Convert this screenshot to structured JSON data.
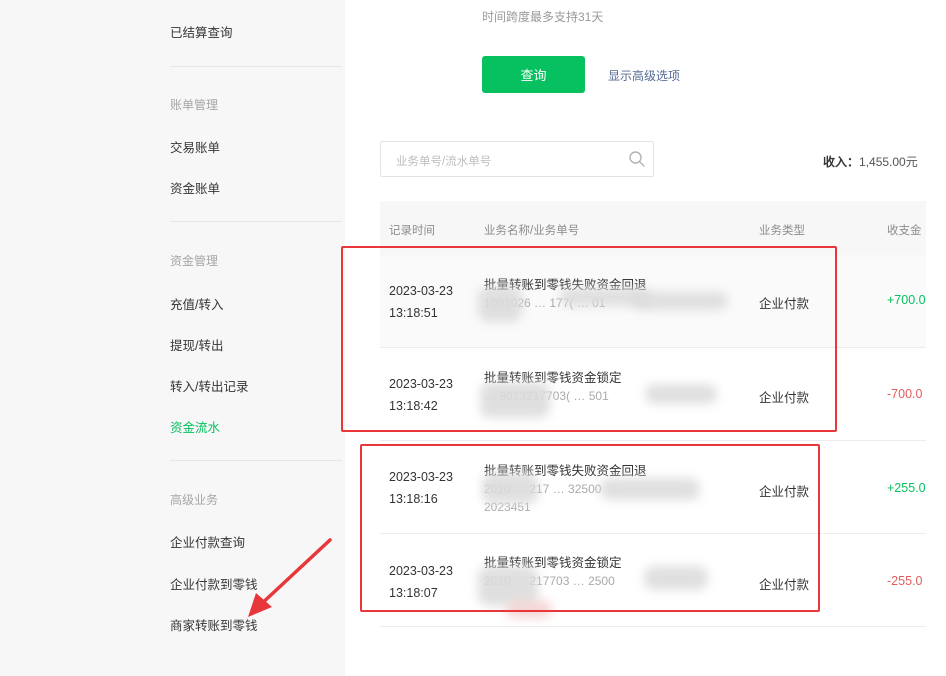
{
  "sidebar": {
    "top_item": "已结算查询",
    "groups": [
      {
        "title": "账单管理",
        "items": [
          "交易账单",
          "资金账单"
        ]
      },
      {
        "title": "资金管理",
        "items": [
          "充值/转入",
          "提现/转出",
          "转入/转出记录",
          "资金流水"
        ]
      },
      {
        "title": "高级业务",
        "items": [
          "企业付款查询",
          "企业付款到零钱",
          "商家转账到零钱"
        ]
      }
    ],
    "active_item": "资金流水",
    "accent_color": "#07c160"
  },
  "filters": {
    "hint": "时间跨度最多支持31天",
    "query_button": "查询",
    "advanced_link": "显示高级选项"
  },
  "search": {
    "placeholder": "业务单号/流水单号",
    "icon": "search-icon"
  },
  "summary": {
    "income_label": "收入：",
    "income_value": "1,455.00元"
  },
  "table": {
    "headers": [
      "记录时间",
      "业务名称/业务单号",
      "业务类型",
      "收支金"
    ],
    "rows": [
      {
        "date": "2023-03-23",
        "time": "13:18:51",
        "name": "批量转账到零钱失败资金回退",
        "number": "1001026 … 177( … 01",
        "type": "企业付款",
        "amount": "+700.0",
        "sign": "positive"
      },
      {
        "date": "2023-03-23",
        "time": "13:18:42",
        "name": "批量转账到零钱资金锁定",
        "number": "… 9013217703( … 501",
        "type": "企业付款",
        "amount": "-700.0",
        "sign": "negative"
      },
      {
        "date": "2023-03-23",
        "time": "13:18:16",
        "name": "批量转账到零钱失败资金回退",
        "number": "2010 … 217 … 32500",
        "number2": "2023451",
        "type": "企业付款",
        "amount": "+255.0",
        "sign": "positive"
      },
      {
        "date": "2023-03-23",
        "time": "13:18:07",
        "name": "批量转账到零钱资金锁定",
        "number": "2010 … 217703 … 2500",
        "type": "企业付款",
        "amount": "-255.0",
        "sign": "negative"
      }
    ]
  },
  "annotation_color": "#e8373a"
}
